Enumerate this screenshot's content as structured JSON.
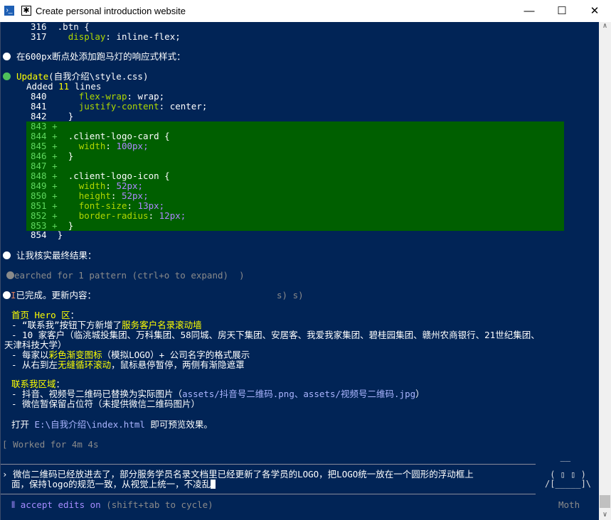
{
  "window": {
    "title": "Create personal introduction website",
    "minimize": "—",
    "maximize": "☐",
    "close": "✕"
  },
  "code_top": [
    {
      "n": "316",
      "code": ".btn {"
    },
    {
      "n": "317",
      "prop": "display",
      "val": "inline-flex;"
    }
  ],
  "msg1": "在600px断点处添加跑马灯的响应式样式：",
  "update": {
    "tool": "Update",
    "path": "(自我介绍\\style.css)",
    "added_pre": "Added ",
    "added_n": "11",
    "added_post": " lines"
  },
  "ctx_lines": [
    {
      "n": "840",
      "prop": "flex-wrap",
      "val": "wrap;"
    },
    {
      "n": "841",
      "prop": "justify-content",
      "val": "center;"
    },
    {
      "n": "842",
      "code": "}"
    }
  ],
  "diff_lines": [
    {
      "n": "843",
      "code": ""
    },
    {
      "n": "844",
      "code": ".client-logo-card {"
    },
    {
      "n": "845",
      "prop": "width",
      "val": "100px;"
    },
    {
      "n": "846",
      "code": "}"
    },
    {
      "n": "847",
      "code": ""
    },
    {
      "n": "848",
      "code": ".client-logo-icon {"
    },
    {
      "n": "849",
      "prop": "width",
      "val": "52px;"
    },
    {
      "n": "850",
      "prop": "height",
      "val": "52px;"
    },
    {
      "n": "851",
      "prop": "font-size",
      "val": "13px;"
    },
    {
      "n": "852",
      "prop": "border-radius",
      "val": "12px;"
    },
    {
      "n": "853",
      "code": "}"
    }
  ],
  "ctx_end": {
    "n": "854",
    "code": "}"
  },
  "msg2": "让我核实最终结果：",
  "searched": "earched for 1 pattern (ctrl+o to expand)  )",
  "done": {
    "prefix": "I",
    "text": "已完成。更新内容：",
    "artifacts": "s) s)"
  },
  "summary": {
    "hero_title": "首页 Hero 区",
    "hero_colon": "：",
    "l1_pre": "- “联系我”按钮下方新增了",
    "l1_hl": "服务客户名录滚动墙",
    "l2": "- 10 家客户（临洮城投集团、万科集团、58同城、房天下集团、安居客、我爱我家集团、碧桂园集团、赣州农商银行、21世纪集团、",
    "l3": "天津科技大学）",
    "l4_pre": "- 每家以",
    "l4_hl": "彩色渐变图标",
    "l4_post": "（模拟LOGO）+ 公司名字的格式展示",
    "l5_pre": "- 从右到左",
    "l5_hl": "无缝循环滚动",
    "l5_post": "，鼠标悬停暂停，两侧有渐隐遮罩",
    "contact_title": "联系我区域",
    "c1_pre": "- 抖音、视频号二维码已替换为实际图片（",
    "c1_code": "assets/抖音号二维码.png、assets/视频号二维码.jpg",
    "c1_post": "）",
    "c2": "- 微信暂保留占位符（未提供微信二维码图片）",
    "open_pre": "打开 ",
    "open_path": "E:\\自我介绍\\index.html",
    "open_post": " 即可预览效果。"
  },
  "worked": "Worked for 4m 4s",
  "input": {
    "line1": "微信二维码已经放进去了，部分服务学员名录文档里已经更新了各学员的LOGO，把LOGO统一放在一个圆形的浮动框上",
    "line2": "面，保持logo的规范一致，从视觉上统一，不凌乱"
  },
  "status": {
    "mode": "accept edits on",
    "hint": " (shift+tab to cycle)",
    "name": "Moth"
  }
}
